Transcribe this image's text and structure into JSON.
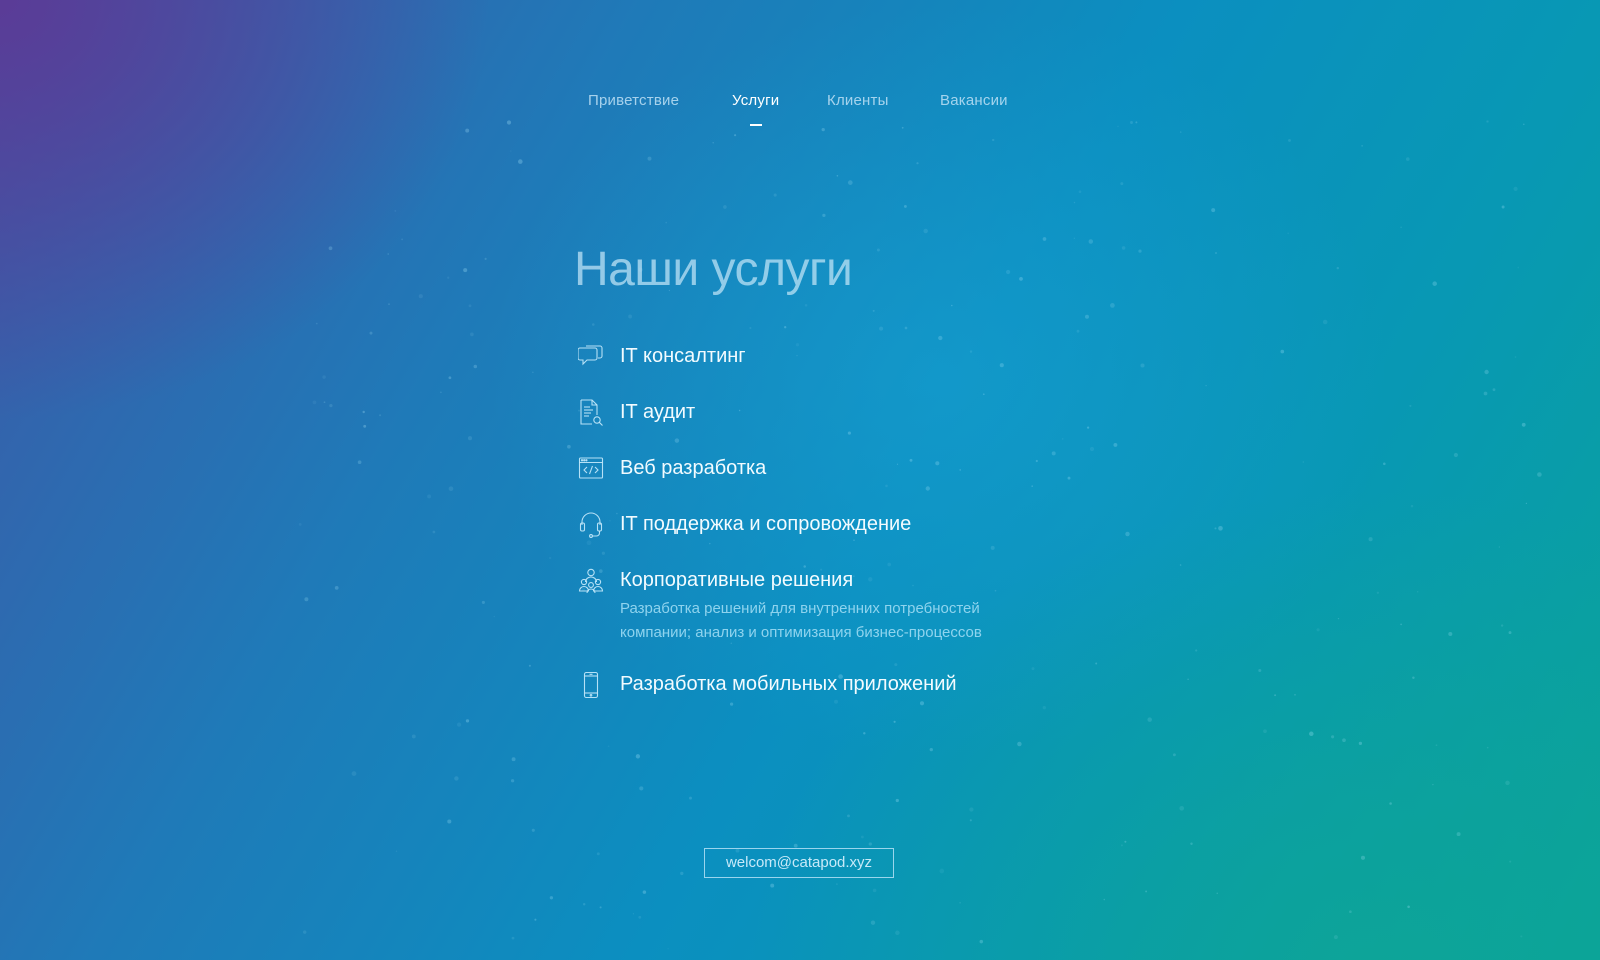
{
  "nav": {
    "items": [
      {
        "label": "Приветствие",
        "active": false
      },
      {
        "label": "Услуги",
        "active": true
      },
      {
        "label": "Клиенты",
        "active": false
      },
      {
        "label": "Вакансии",
        "active": false
      }
    ]
  },
  "services": {
    "title": "Наши услуги",
    "items": [
      {
        "icon": "chat-bubbles-icon",
        "label": "IT консалтинг"
      },
      {
        "icon": "document-search-icon",
        "label": "IT аудит"
      },
      {
        "icon": "code-window-icon",
        "label": "Веб разработка"
      },
      {
        "icon": "headset-icon",
        "label": "IT поддержка и сопровождение"
      },
      {
        "icon": "people-group-icon",
        "label": "Корпоративные решения",
        "description": "Разработка решений для внутренних потребностей компании; анализ и оптимизация бизнес-процессов"
      },
      {
        "icon": "smartphone-icon",
        "label": "Разработка мобильных приложений"
      }
    ]
  },
  "contact": {
    "email": "welcom@catapod.xyz"
  },
  "colors": {
    "accent": "#ffffff",
    "muted_text": "#96d7f0",
    "background_start": "#5c3a96",
    "background_end": "#0aa39a"
  }
}
